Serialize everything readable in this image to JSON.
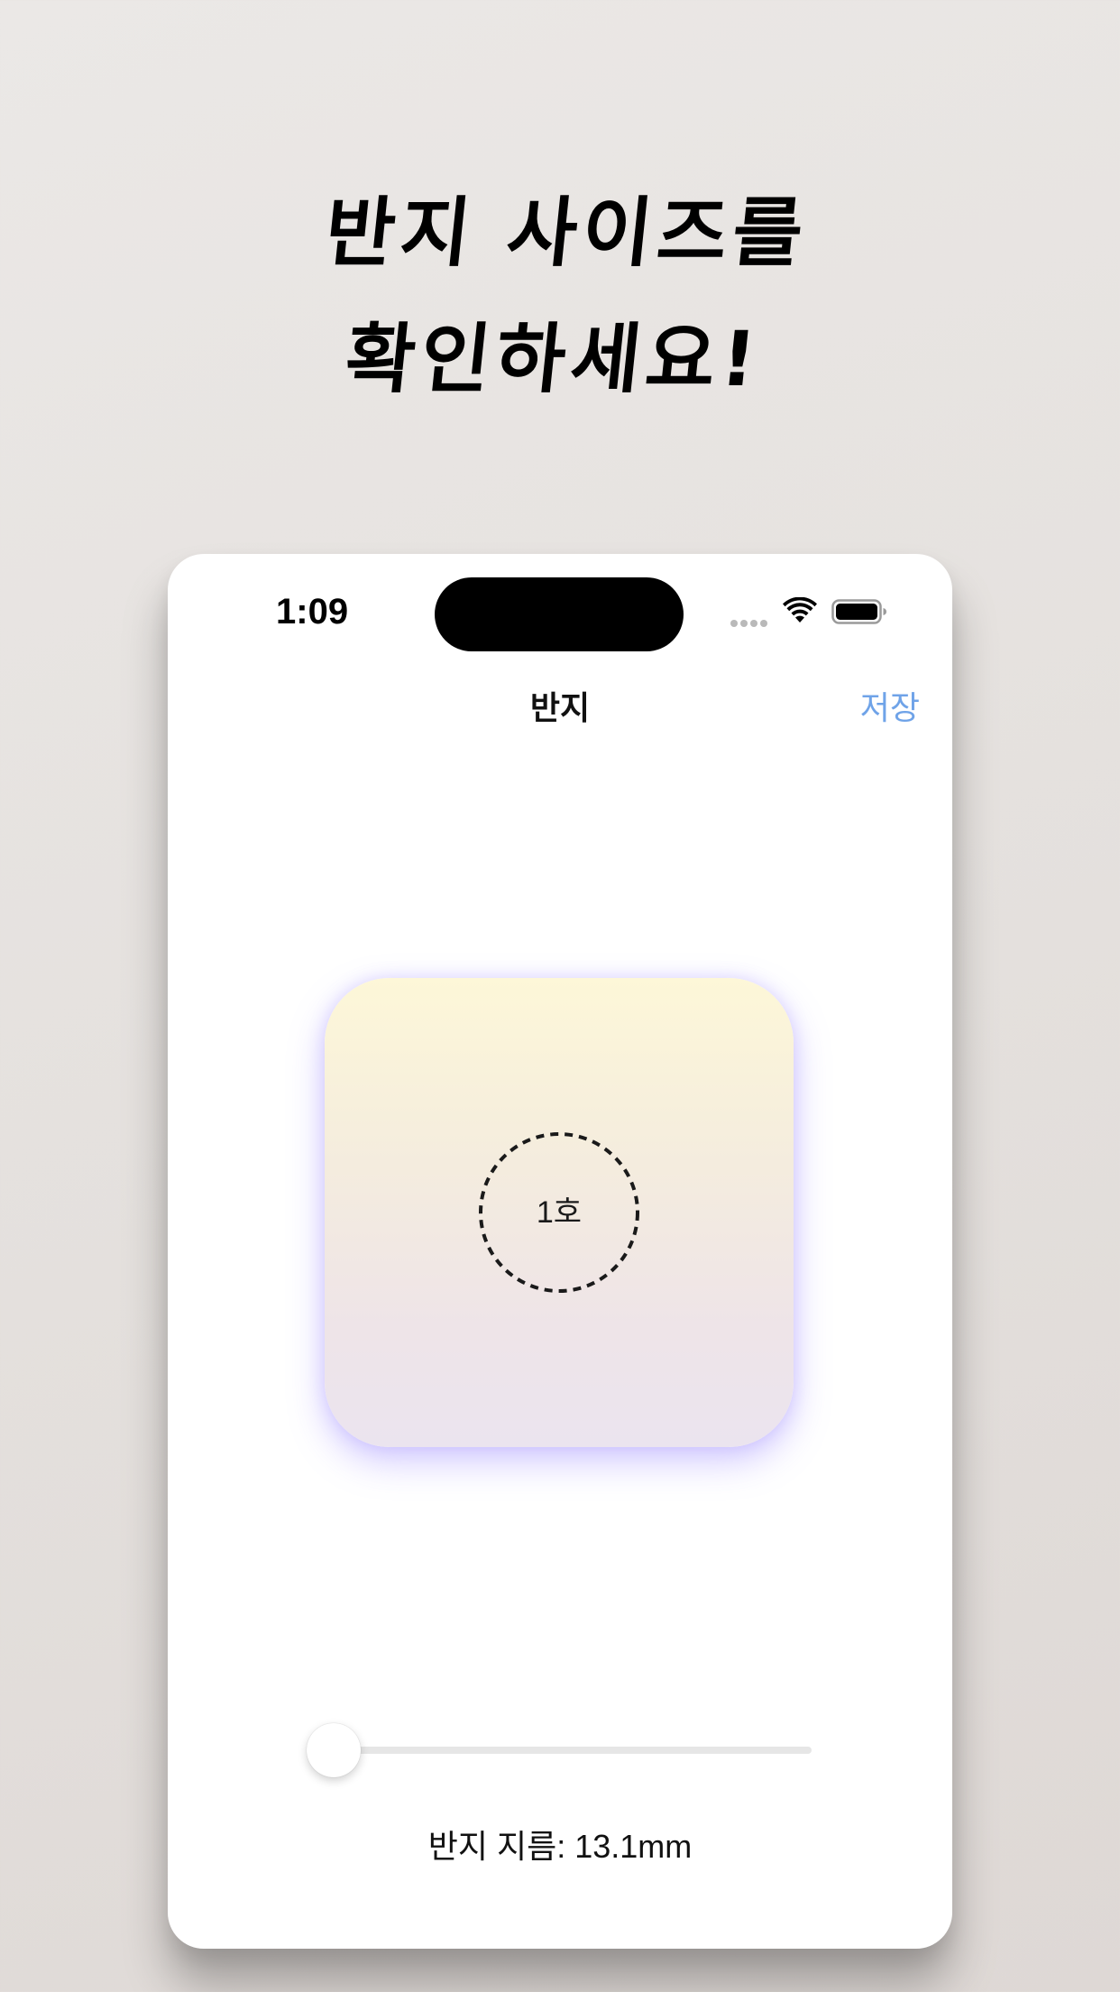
{
  "promo": {
    "headline_line1": "반지 사이즈를",
    "headline_line2": "확인하세요!"
  },
  "status_bar": {
    "time": "1:09"
  },
  "nav": {
    "title": "반지",
    "save_label": "저장"
  },
  "ring_preview": {
    "size_label": "1호"
  },
  "slider": {
    "value_fraction": 0.0
  },
  "measurement": {
    "diameter_text": "반지 지름: 13.1mm"
  },
  "colors": {
    "accent": "#6fa3e8",
    "card_top": "#fdf7d8",
    "card_bottom": "#ebe4ef",
    "card_glow": "#9682ff"
  }
}
